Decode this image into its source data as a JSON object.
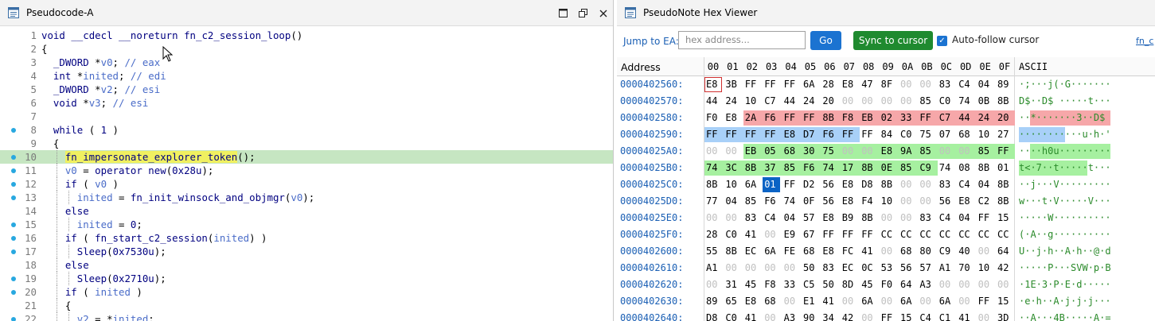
{
  "left_panel": {
    "title": "Pseudocode-A",
    "code_lines": [
      {
        "n": "1",
        "dot": false,
        "hl": false,
        "depth": 0,
        "parts": [
          [
            "k",
            "void "
          ],
          [
            "k",
            "__cdecl "
          ],
          [
            "k",
            "__noreturn "
          ],
          [
            "n",
            "fn_c2_session_loop"
          ],
          [
            "t",
            "()"
          ]
        ]
      },
      {
        "n": "2",
        "dot": false,
        "hl": false,
        "depth": 0,
        "parts": [
          [
            "t",
            "{"
          ]
        ]
      },
      {
        "n": "3",
        "dot": false,
        "hl": false,
        "depth": 0,
        "parts": [
          [
            "t",
            "  "
          ],
          [
            "k",
            "_DWORD "
          ],
          [
            "t",
            "*"
          ],
          [
            "v",
            "v0"
          ],
          [
            "t",
            "; "
          ],
          [
            "c",
            "// eax"
          ]
        ]
      },
      {
        "n": "4",
        "dot": false,
        "hl": false,
        "depth": 0,
        "parts": [
          [
            "t",
            "  "
          ],
          [
            "k",
            "int "
          ],
          [
            "t",
            "*"
          ],
          [
            "v",
            "inited"
          ],
          [
            "t",
            "; "
          ],
          [
            "c",
            "// edi"
          ]
        ]
      },
      {
        "n": "5",
        "dot": false,
        "hl": false,
        "depth": 0,
        "parts": [
          [
            "t",
            "  "
          ],
          [
            "k",
            "_DWORD "
          ],
          [
            "t",
            "*"
          ],
          [
            "v",
            "v2"
          ],
          [
            "t",
            "; "
          ],
          [
            "c",
            "// esi"
          ]
        ]
      },
      {
        "n": "6",
        "dot": false,
        "hl": false,
        "depth": 0,
        "parts": [
          [
            "t",
            "  "
          ],
          [
            "k",
            "void "
          ],
          [
            "t",
            "*"
          ],
          [
            "v",
            "v3"
          ],
          [
            "t",
            "; "
          ],
          [
            "c",
            "// esi"
          ]
        ]
      },
      {
        "n": "7",
        "dot": false,
        "hl": false,
        "depth": 0,
        "parts": []
      },
      {
        "n": "8",
        "dot": true,
        "hl": false,
        "depth": 0,
        "parts": [
          [
            "t",
            "  "
          ],
          [
            "k",
            "while "
          ],
          [
            "t",
            "( "
          ],
          [
            "n",
            "1"
          ],
          [
            "t",
            " )"
          ]
        ]
      },
      {
        "n": "9",
        "dot": false,
        "hl": false,
        "depth": 0,
        "parts": [
          [
            "t",
            "  {"
          ]
        ]
      },
      {
        "n": "10",
        "dot": true,
        "hl": true,
        "depth": 1,
        "parts": [
          [
            "t",
            "    "
          ],
          [
            "fnhl",
            "fn_impersonate_explorer_token"
          ],
          [
            "t",
            "();"
          ]
        ]
      },
      {
        "n": "11",
        "dot": true,
        "hl": false,
        "depth": 1,
        "parts": [
          [
            "t",
            "    "
          ],
          [
            "v",
            "v0"
          ],
          [
            "t",
            " = "
          ],
          [
            "n",
            "operator new"
          ],
          [
            "t",
            "("
          ],
          [
            "n",
            "0x28u"
          ],
          [
            "t",
            ");"
          ]
        ]
      },
      {
        "n": "12",
        "dot": true,
        "hl": false,
        "depth": 1,
        "parts": [
          [
            "t",
            "    "
          ],
          [
            "k",
            "if "
          ],
          [
            "t",
            "( "
          ],
          [
            "v",
            "v0"
          ],
          [
            "t",
            " )"
          ]
        ]
      },
      {
        "n": "13",
        "dot": true,
        "hl": false,
        "depth": 2,
        "parts": [
          [
            "t",
            "      "
          ],
          [
            "v",
            "inited"
          ],
          [
            "t",
            " = "
          ],
          [
            "n",
            "fn_init_winsock_and_objmgr"
          ],
          [
            "t",
            "("
          ],
          [
            "v",
            "v0"
          ],
          [
            "t",
            ");"
          ]
        ]
      },
      {
        "n": "14",
        "dot": false,
        "hl": false,
        "depth": 1,
        "parts": [
          [
            "t",
            "    "
          ],
          [
            "k",
            "else"
          ]
        ]
      },
      {
        "n": "15",
        "dot": true,
        "hl": false,
        "depth": 2,
        "parts": [
          [
            "t",
            "      "
          ],
          [
            "v",
            "inited"
          ],
          [
            "t",
            " = "
          ],
          [
            "n",
            "0"
          ],
          [
            "t",
            ";"
          ]
        ]
      },
      {
        "n": "16",
        "dot": true,
        "hl": false,
        "depth": 1,
        "parts": [
          [
            "t",
            "    "
          ],
          [
            "k",
            "if "
          ],
          [
            "t",
            "( "
          ],
          [
            "n",
            "fn_start_c2_session"
          ],
          [
            "t",
            "("
          ],
          [
            "v",
            "inited"
          ],
          [
            "t",
            ") )"
          ]
        ]
      },
      {
        "n": "17",
        "dot": true,
        "hl": false,
        "depth": 2,
        "parts": [
          [
            "t",
            "      "
          ],
          [
            "n",
            "Sleep"
          ],
          [
            "t",
            "("
          ],
          [
            "n",
            "0x7530u"
          ],
          [
            "t",
            ");"
          ]
        ]
      },
      {
        "n": "18",
        "dot": false,
        "hl": false,
        "depth": 1,
        "parts": [
          [
            "t",
            "    "
          ],
          [
            "k",
            "else"
          ]
        ]
      },
      {
        "n": "19",
        "dot": true,
        "hl": false,
        "depth": 2,
        "parts": [
          [
            "t",
            "      "
          ],
          [
            "n",
            "Sleep"
          ],
          [
            "t",
            "("
          ],
          [
            "n",
            "0x2710u"
          ],
          [
            "t",
            ");"
          ]
        ]
      },
      {
        "n": "20",
        "dot": true,
        "hl": false,
        "depth": 1,
        "parts": [
          [
            "t",
            "    "
          ],
          [
            "k",
            "if "
          ],
          [
            "t",
            "( "
          ],
          [
            "v",
            "inited"
          ],
          [
            "t",
            " )"
          ]
        ]
      },
      {
        "n": "21",
        "dot": false,
        "hl": false,
        "depth": 1,
        "parts": [
          [
            "t",
            "    {"
          ]
        ]
      },
      {
        "n": "22",
        "dot": true,
        "hl": false,
        "depth": 2,
        "parts": [
          [
            "t",
            "      "
          ],
          [
            "v",
            "v2"
          ],
          [
            "t",
            " = *"
          ],
          [
            "v",
            "inited"
          ],
          [
            "t",
            ";"
          ]
        ]
      }
    ]
  },
  "right_panel": {
    "title": "PseudoNote Hex Viewer",
    "jump_label": "Jump to EA:",
    "address_placeholder": "hex address...",
    "go_label": "Go",
    "sync_label": "Sync to cursor",
    "autofollow_label": "Auto-follow cursor",
    "autofollow_checked": true,
    "link_label": "fn_c",
    "address_header": "Address",
    "ascii_header": "ASCII",
    "columns": [
      "00",
      "01",
      "02",
      "03",
      "04",
      "05",
      "06",
      "07",
      "08",
      "09",
      "0A",
      "0B",
      "0C",
      "0D",
      "0E",
      "0F"
    ],
    "rows": [
      {
        "addr": "0000402560:",
        "bytes": [
          "E8",
          "3B",
          "FF",
          "FF",
          "FF",
          "6A",
          "28",
          "E8",
          "47",
          "8F",
          "00",
          "00",
          "83",
          "C4",
          "04",
          "89"
        ],
        "ascii": "·;···j(·G·······"
      },
      {
        "addr": "0000402570:",
        "bytes": [
          "44",
          "24",
          "10",
          "C7",
          "44",
          "24",
          "20",
          "00",
          "00",
          "00",
          "00",
          "85",
          "C0",
          "74",
          "0B",
          "8B"
        ],
        "ascii": "D$··D$ ·····t···"
      },
      {
        "addr": "0000402580:",
        "bytes": [
          "F0",
          "E8",
          "2A",
          "F6",
          "FF",
          "FF",
          "8B",
          "F8",
          "EB",
          "02",
          "33",
          "FF",
          "C7",
          "44",
          "24",
          "20"
        ],
        "ascii": "··*·······3··D$ "
      },
      {
        "addr": "0000402590:",
        "bytes": [
          "FF",
          "FF",
          "FF",
          "FF",
          "E8",
          "D7",
          "F6",
          "FF",
          "FF",
          "84",
          "C0",
          "75",
          "07",
          "68",
          "10",
          "27"
        ],
        "ascii": "···········u·h·'"
      },
      {
        "addr": "00004025A0:",
        "bytes": [
          "00",
          "00",
          "EB",
          "05",
          "68",
          "30",
          "75",
          "00",
          "00",
          "E8",
          "9A",
          "85",
          "00",
          "00",
          "85",
          "FF"
        ],
        "ascii": "····h0u·········"
      },
      {
        "addr": "00004025B0:",
        "bytes": [
          "74",
          "3C",
          "8B",
          "37",
          "85",
          "F6",
          "74",
          "17",
          "8B",
          "0E",
          "85",
          "C9",
          "74",
          "08",
          "8B",
          "01"
        ],
        "ascii": "t<·7··t·····t···"
      },
      {
        "addr": "00004025C0:",
        "bytes": [
          "8B",
          "10",
          "6A",
          "01",
          "FF",
          "D2",
          "56",
          "E8",
          "D8",
          "8B",
          "00",
          "00",
          "83",
          "C4",
          "04",
          "8B"
        ],
        "ascii": "··j···V·········"
      },
      {
        "addr": "00004025D0:",
        "bytes": [
          "77",
          "04",
          "85",
          "F6",
          "74",
          "0F",
          "56",
          "E8",
          "F4",
          "10",
          "00",
          "00",
          "56",
          "E8",
          "C2",
          "8B"
        ],
        "ascii": "w···t·V·····V···"
      },
      {
        "addr": "00004025E0:",
        "bytes": [
          "00",
          "00",
          "83",
          "C4",
          "04",
          "57",
          "E8",
          "B9",
          "8B",
          "00",
          "00",
          "83",
          "C4",
          "04",
          "FF",
          "15"
        ],
        "ascii": "·····W··········"
      },
      {
        "addr": "00004025F0:",
        "bytes": [
          "28",
          "C0",
          "41",
          "00",
          "E9",
          "67",
          "FF",
          "FF",
          "FF",
          "CC",
          "CC",
          "CC",
          "CC",
          "CC",
          "CC",
          "CC"
        ],
        "ascii": "(·A··g··········"
      },
      {
        "addr": "0000402600:",
        "bytes": [
          "55",
          "8B",
          "EC",
          "6A",
          "FE",
          "68",
          "E8",
          "FC",
          "41",
          "00",
          "68",
          "80",
          "C9",
          "40",
          "00",
          "64"
        ],
        "ascii": "U··j·h··A·h··@·d"
      },
      {
        "addr": "0000402610:",
        "bytes": [
          "A1",
          "00",
          "00",
          "00",
          "00",
          "50",
          "83",
          "EC",
          "0C",
          "53",
          "56",
          "57",
          "A1",
          "70",
          "10",
          "42"
        ],
        "ascii": "·····P···SVW·p·B"
      },
      {
        "addr": "0000402620:",
        "bytes": [
          "00",
          "31",
          "45",
          "F8",
          "33",
          "C5",
          "50",
          "8D",
          "45",
          "F0",
          "64",
          "A3",
          "00",
          "00",
          "00",
          "00"
        ],
        "ascii": "·1E·3·P·E·d·····"
      },
      {
        "addr": "0000402630:",
        "bytes": [
          "89",
          "65",
          "E8",
          "68",
          "00",
          "E1",
          "41",
          "00",
          "6A",
          "00",
          "6A",
          "00",
          "6A",
          "00",
          "FF",
          "15"
        ],
        "ascii": "·e·h··A·j·j·j···"
      },
      {
        "addr": "0000402640:",
        "bytes": [
          "D8",
          "C0",
          "41",
          "00",
          "A3",
          "90",
          "34",
          "42",
          "00",
          "FF",
          "15",
          "C4",
          "C1",
          "41",
          "00",
          "3D"
        ],
        "ascii": "··A···4B·····A·="
      }
    ],
    "colors": {
      "red": "#f6a7a9",
      "blue": "#a8d0f8",
      "green": "#a6f0a0",
      "cursor": "#0b63c5"
    }
  }
}
